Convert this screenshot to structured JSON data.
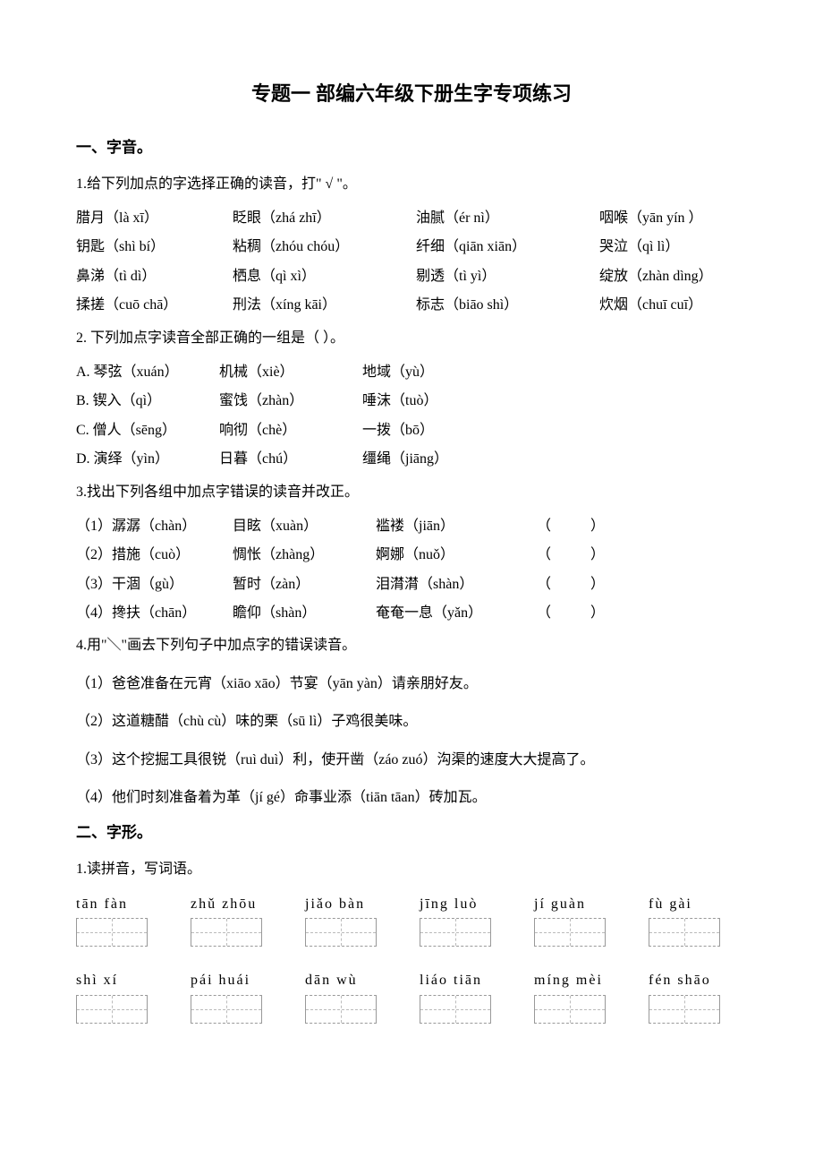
{
  "title": "专题一 部编六年级下册生字专项练习",
  "sec1": {
    "head": "一、字音。",
    "q1": {
      "stem": "1.给下列加点的字选择正确的读音，打\" √ \"。",
      "rows": [
        [
          "腊月（là xī）",
          "眨眼（zhá zhī）",
          "油腻（ér nì）",
          "咽喉（yān yín ）"
        ],
        [
          "钥匙（shì bí）",
          "粘稠（zhóu chóu）",
          "纤细（qiān xiān）",
          "哭泣（qì lì）"
        ],
        [
          "鼻涕（tì dì）",
          "栖息（qì xì）",
          "剔透（tì yì）",
          "绽放（zhàn dìng）"
        ],
        [
          "揉搓（cuō chā）",
          "刑法（xíng kāi）",
          "标志（biāo   shì）",
          "炊烟（chuī cuī）"
        ]
      ]
    },
    "q2": {
      "stem": "2.  下列加点字读音全部正确的一组是（     ）。",
      "opts": [
        [
          "A.  琴弦（xuán）",
          "机械（xiè）",
          "地域（yù）"
        ],
        [
          "B.  锲入（qì）",
          "蜜饯（zhàn）",
          "唾沫（tuò）"
        ],
        [
          "C.  僧人（sēng）",
          "响彻（chè）",
          "一拨（bō）"
        ],
        [
          "D.  演绎（yìn）",
          "日暮（chú）",
          "缰绳（jiāng）"
        ]
      ]
    },
    "q3": {
      "stem": "3.找出下列各组中加点字错误的读音并改正。",
      "rows": [
        [
          "（1）潺潺（chàn）",
          "目眩（xuàn）",
          "褴褛（jiān）",
          "（",
          "）"
        ],
        [
          "（2）措施（cuò）",
          "惆怅（zhàng）",
          "婀娜（nuǒ）",
          "（",
          "）"
        ],
        [
          "（3）干涸（gù）",
          "暂时（zàn）",
          "泪潸潸（shàn）",
          "（",
          "）"
        ],
        [
          "（4）搀扶（chān）",
          "瞻仰（shàn）",
          "奄奄一息（yǎn）",
          "（",
          "）"
        ]
      ]
    },
    "q4": {
      "stem": "4.用\"＼\"画去下列句子中加点字的错误读音。",
      "items": [
        "（1）爸爸准备在元宵（xiāo xāo）节宴（yān yàn）请亲朋好友。",
        "（2）这道糖醋（chù cù）味的栗（sū lì）子鸡很美味。",
        "（3）这个挖掘工具很锐（ruì duì）利，使开凿（záo zuó）沟渠的速度大大提高了。",
        "（4）他们时刻准备着为革（jí gé）命事业添（tiān tāan）砖加瓦。"
      ]
    }
  },
  "sec2": {
    "head": "二、字形。",
    "q1": {
      "stem": "1.读拼音，写词语。",
      "rows": [
        [
          "tān  fàn",
          "zhǔ  zhōu",
          "jiǎo bàn",
          "jīng  luò",
          "jí  guàn",
          "fù  gài"
        ],
        [
          "shì  xí",
          "pái  huái",
          "dān  wù",
          "liáo  tiān",
          "míng mèi",
          "fén shāo"
        ]
      ]
    }
  }
}
